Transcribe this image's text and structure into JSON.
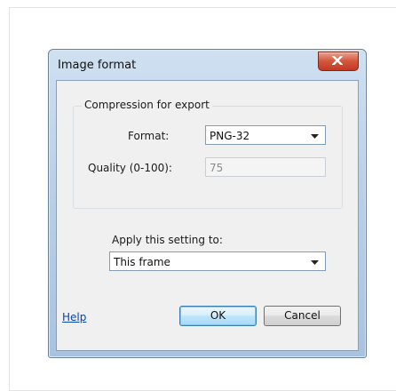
{
  "dialog": {
    "title": "Image format",
    "close_symbol": "X",
    "group_title": "Compression for export",
    "format_label": "Format:",
    "format_value": "PNG-32",
    "quality_label": "Quality (0-100):",
    "quality_value": "75",
    "apply_label": "Apply this setting to:",
    "apply_value": "This frame",
    "help_link": "Help",
    "ok_label": "OK",
    "cancel_label": "Cancel"
  },
  "icons": {
    "close": "close-icon",
    "dropdown": "chevron-down-icon"
  },
  "colors": {
    "titlebar": "#bcd1e8",
    "close_button": "#c13a22",
    "link": "#0645ad",
    "default_button_border": "#3c7fb1"
  }
}
